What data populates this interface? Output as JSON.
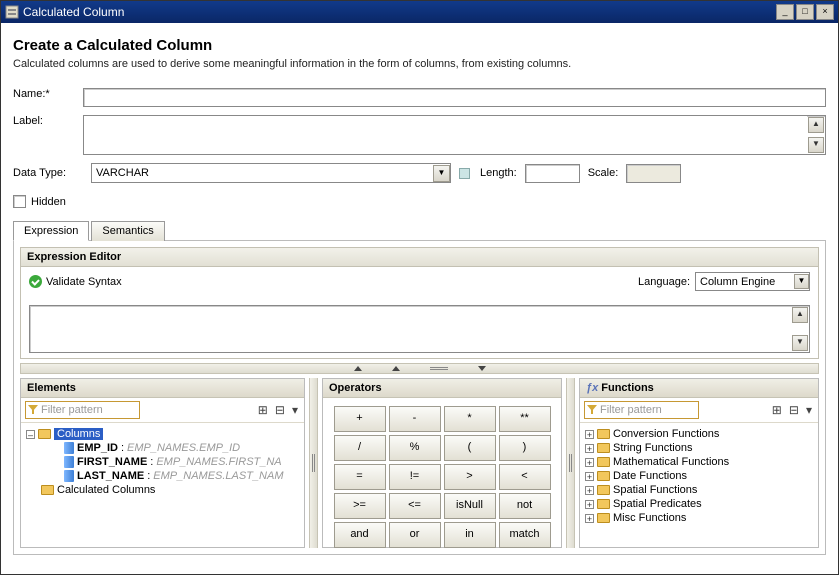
{
  "window": {
    "title": "Calculated Column"
  },
  "header": {
    "heading": "Create a Calculated Column",
    "subtext": "Calculated columns are used to derive some meaningful information in the form of columns, from existing columns."
  },
  "form": {
    "name_label": "Name:*",
    "name_value": "",
    "label_label": "Label:",
    "label_value": "",
    "datatype_label": "Data Type:",
    "datatype_value": "VARCHAR",
    "length_label": "Length:",
    "length_value": "",
    "scale_label": "Scale:",
    "scale_value": "",
    "hidden_label": "Hidden"
  },
  "tabs": {
    "expression": "Expression",
    "semantics": "Semantics"
  },
  "editor": {
    "groupbox_title": "Expression Editor",
    "validate": "Validate Syntax",
    "language_label": "Language:",
    "language_value": "Column Engine",
    "expression_text": ""
  },
  "elements": {
    "title": "Elements",
    "filter_placeholder": "Filter pattern",
    "root": "Columns",
    "items": [
      {
        "name": "EMP_ID",
        "desc": "EMP_NAMES.EMP_ID"
      },
      {
        "name": "FIRST_NAME",
        "desc": "EMP_NAMES.FIRST_NA"
      },
      {
        "name": "LAST_NAME",
        "desc": "EMP_NAMES.LAST_NAM"
      }
    ],
    "calc_folder": "Calculated Columns"
  },
  "operators": {
    "title": "Operators",
    "buttons": [
      "+",
      "-",
      "*",
      "**",
      "/",
      "%",
      "(",
      ")",
      "=",
      "!=",
      ">",
      "<",
      ">=",
      "<=",
      "isNull",
      "not",
      "and",
      "or",
      "in",
      "match"
    ]
  },
  "functions": {
    "title": "Functions",
    "filter_placeholder": "Filter pattern",
    "categories": [
      "Conversion Functions",
      "String Functions",
      "Mathematical Functions",
      "Date Functions",
      "Spatial Functions",
      "Spatial Predicates",
      "Misc Functions"
    ]
  }
}
